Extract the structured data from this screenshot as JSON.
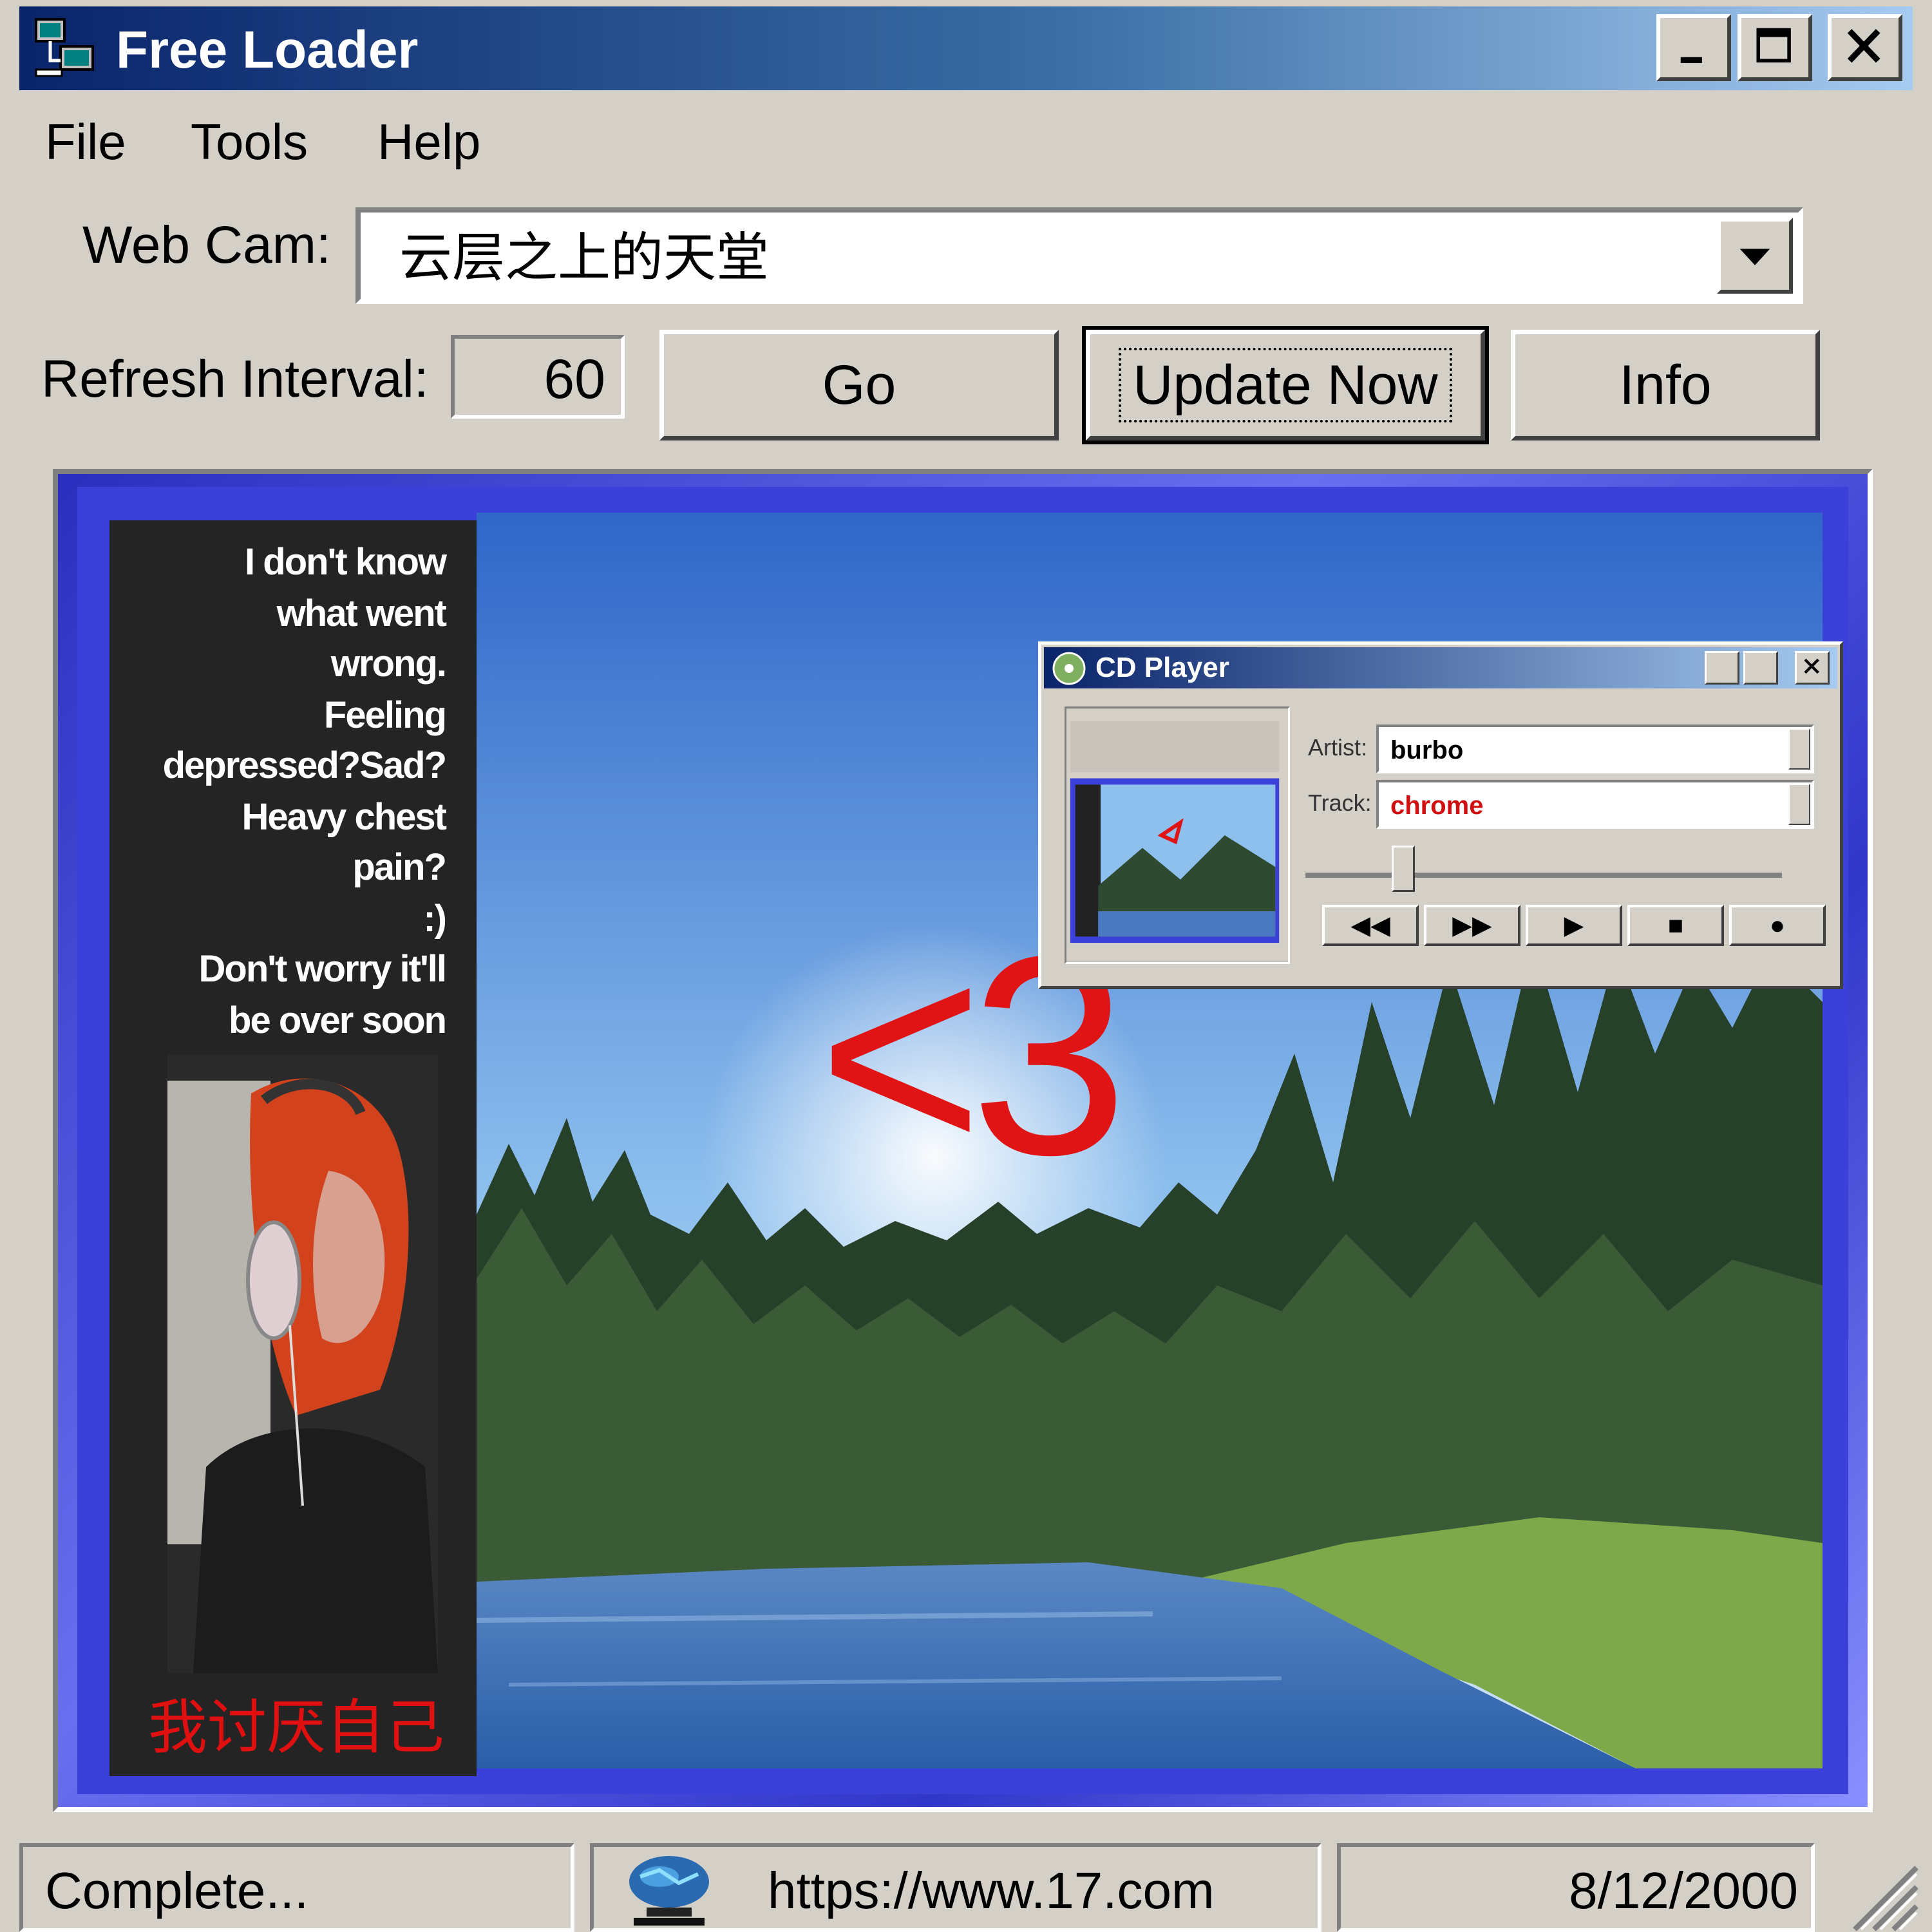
{
  "window": {
    "title": "Free Loader"
  },
  "menu": {
    "file": "File",
    "tools": "Tools",
    "help": "Help"
  },
  "webcam": {
    "label": "Web Cam:",
    "value": "云层之上的天堂"
  },
  "refresh": {
    "label": "Refresh Interval:",
    "value": "60"
  },
  "buttons": {
    "go": "Go",
    "update": "Update Now",
    "info": "Info"
  },
  "cam_image": {
    "sidebar_lines": [
      "I don't know",
      "what went",
      "wrong.",
      "Feeling",
      "depressed?Sad?",
      "Heavy chest",
      "pain?",
      ":)",
      "Don't worry it'll",
      "be over soon"
    ],
    "sidebar_cn": "我讨厌自己",
    "heart": "<3",
    "cd_player": {
      "title": "CD Player",
      "artist_label": "Artist:",
      "artist": "burbo",
      "track_label": "Track:",
      "track": "chrome",
      "controls": [
        "◀◀",
        "▶▶",
        "▶",
        "■",
        "●"
      ]
    }
  },
  "status": {
    "state": "Complete...",
    "url": "https://www.17.com",
    "date": "8/12/2000"
  },
  "colors": {
    "titlebar_start": "#0a246a",
    "titlebar_end": "#a6caf0",
    "face": "#d4d0c8",
    "heart": "#e01414"
  }
}
